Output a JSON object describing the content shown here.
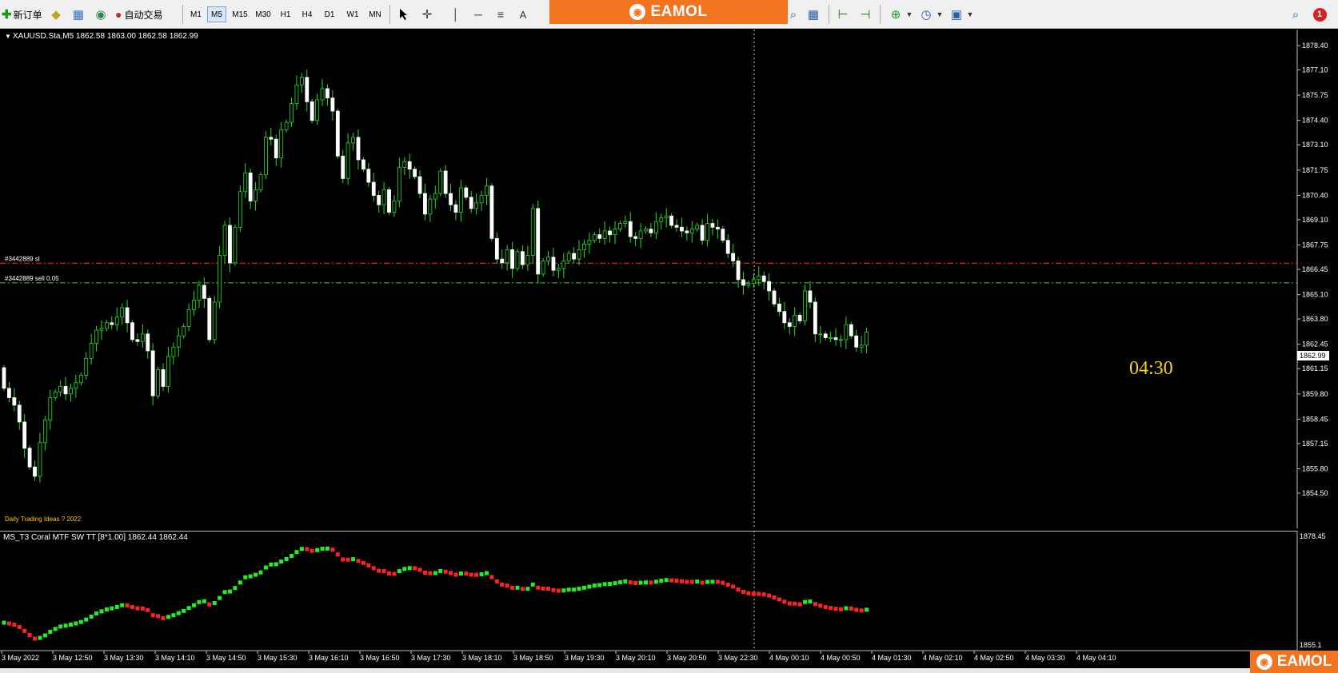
{
  "toolbar": {
    "new_order": "新订单",
    "auto_trading": "自动交易",
    "timeframes": [
      "M1",
      "M5",
      "M15",
      "M30",
      "H1",
      "H4",
      "D1",
      "W1",
      "MN"
    ],
    "selected_timeframe": "M5",
    "text_tool": "A",
    "notification_count": "1"
  },
  "brand": {
    "name": "EAMOL"
  },
  "chart": {
    "header": "XAUUSD.Sta,M5  1862.58 1863.00 1862.58 1862.99",
    "current_price": "1862.99",
    "countdown": "04:30",
    "watermark": "Daily Trading Ideas  ? 2022",
    "sl_line": {
      "label": "#3442889 sl",
      "price": 1866.78,
      "color": "#ff3333"
    },
    "entry_line": {
      "label": "#3442889 sell 0.05",
      "price": 1865.73,
      "color": "#33cc33"
    }
  },
  "indicator": {
    "header": "MS_T3 Coral MTF SW TT [8*1.00] 1862.44 1862.44",
    "scale_top": "1878.45",
    "scale_bottom": "1855.1"
  },
  "chart_data": {
    "type": "candlestick",
    "symbol": "XAUUSD.Sta",
    "timeframe": "M5",
    "price_ticks": [
      "1878.40",
      "1877.10",
      "1875.75",
      "1874.40",
      "1873.10",
      "1871.75",
      "1870.40",
      "1869.10",
      "1867.75",
      "1866.45",
      "1865.10",
      "1863.80",
      "1862.45",
      "1861.15",
      "1859.80",
      "1858.45",
      "1857.15",
      "1855.80",
      "1854.50"
    ],
    "time_labels": [
      "3 May 2022",
      "3 May 12:50",
      "3 May 13:30",
      "3 May 14:10",
      "3 May 14:50",
      "3 May 15:30",
      "3 May 16:10",
      "3 May 16:50",
      "3 May 17:30",
      "3 May 18:10",
      "3 May 18:50",
      "3 May 19:30",
      "3 May 20:10",
      "3 May 20:50",
      "3 May 22:30",
      "4 May 00:10",
      "4 May 00:50",
      "4 May 01:30",
      "4 May 02:10",
      "4 May 02:50",
      "4 May 03:30",
      "4 May 04:10"
    ],
    "ylim": [
      1854.5,
      1878.9
    ],
    "closes": [
      1860.1,
      1859.6,
      1859.2,
      1858.3,
      1856.9,
      1855.9,
      1855.4,
      1857.2,
      1858.4,
      1859.6,
      1859.9,
      1860.2,
      1859.8,
      1860.1,
      1860.4,
      1860.8,
      1861.7,
      1862.5,
      1863.2,
      1863.3,
      1863.6,
      1863.5,
      1863.9,
      1864.4,
      1863.6,
      1862.7,
      1862.6,
      1863.0,
      1862.1,
      1859.7,
      1861.1,
      1860.2,
      1861.8,
      1862.3,
      1862.9,
      1863.4,
      1864.3,
      1864.8,
      1865.6,
      1864.9,
      1862.7,
      1864.7,
      1867.2,
      1868.8,
      1866.8,
      1868.7,
      1870.6,
      1871.6,
      1870.1,
      1870.7,
      1871.5,
      1873.5,
      1873.4,
      1872.4,
      1873.9,
      1874.3,
      1875.3,
      1876.3,
      1876.7,
      1875.4,
      1874.4,
      1875.5,
      1876.1,
      1875.6,
      1874.9,
      1872.5,
      1871.3,
      1873.2,
      1873.5,
      1872.3,
      1871.8,
      1871.1,
      1870.4,
      1869.9,
      1870.7,
      1869.5,
      1870.1,
      1871.9,
      1872.2,
      1871.8,
      1871.4,
      1870.5,
      1869.4,
      1870.2,
      1870.5,
      1871.7,
      1870.5,
      1869.9,
      1869.5,
      1870.8,
      1870.3,
      1869.7,
      1870.0,
      1870.4,
      1870.9,
      1868.1,
      1867.0,
      1866.8,
      1867.5,
      1866.5,
      1867.4,
      1866.7,
      1867.2,
      1869.7,
      1866.2,
      1866.9,
      1867.1,
      1866.4,
      1866.5,
      1866.9,
      1867.3,
      1867.0,
      1867.5,
      1867.8,
      1868.0,
      1868.3,
      1868.1,
      1868.5,
      1868.3,
      1868.6,
      1868.9,
      1869.0,
      1868.2,
      1868.1,
      1868.5,
      1868.6,
      1868.4,
      1869.0,
      1869.2,
      1869.3,
      1868.8,
      1868.7,
      1868.5,
      1868.4,
      1868.6,
      1868.8,
      1868.0,
      1868.9,
      1868.7,
      1868.6,
      1868.0,
      1867.3,
      1866.9,
      1865.9,
      1865.6,
      1865.7,
      1865.9,
      1866.1,
      1865.8,
      1865.3,
      1864.6,
      1864.2,
      1863.6,
      1863.4,
      1864.0,
      1863.7,
      1865.3,
      1864.7,
      1863.0,
      1863.0,
      1862.8,
      1862.8,
      1862.7,
      1862.7,
      1863.5,
      1862.9,
      1862.3,
      1862.4,
      1863.1
    ]
  }
}
